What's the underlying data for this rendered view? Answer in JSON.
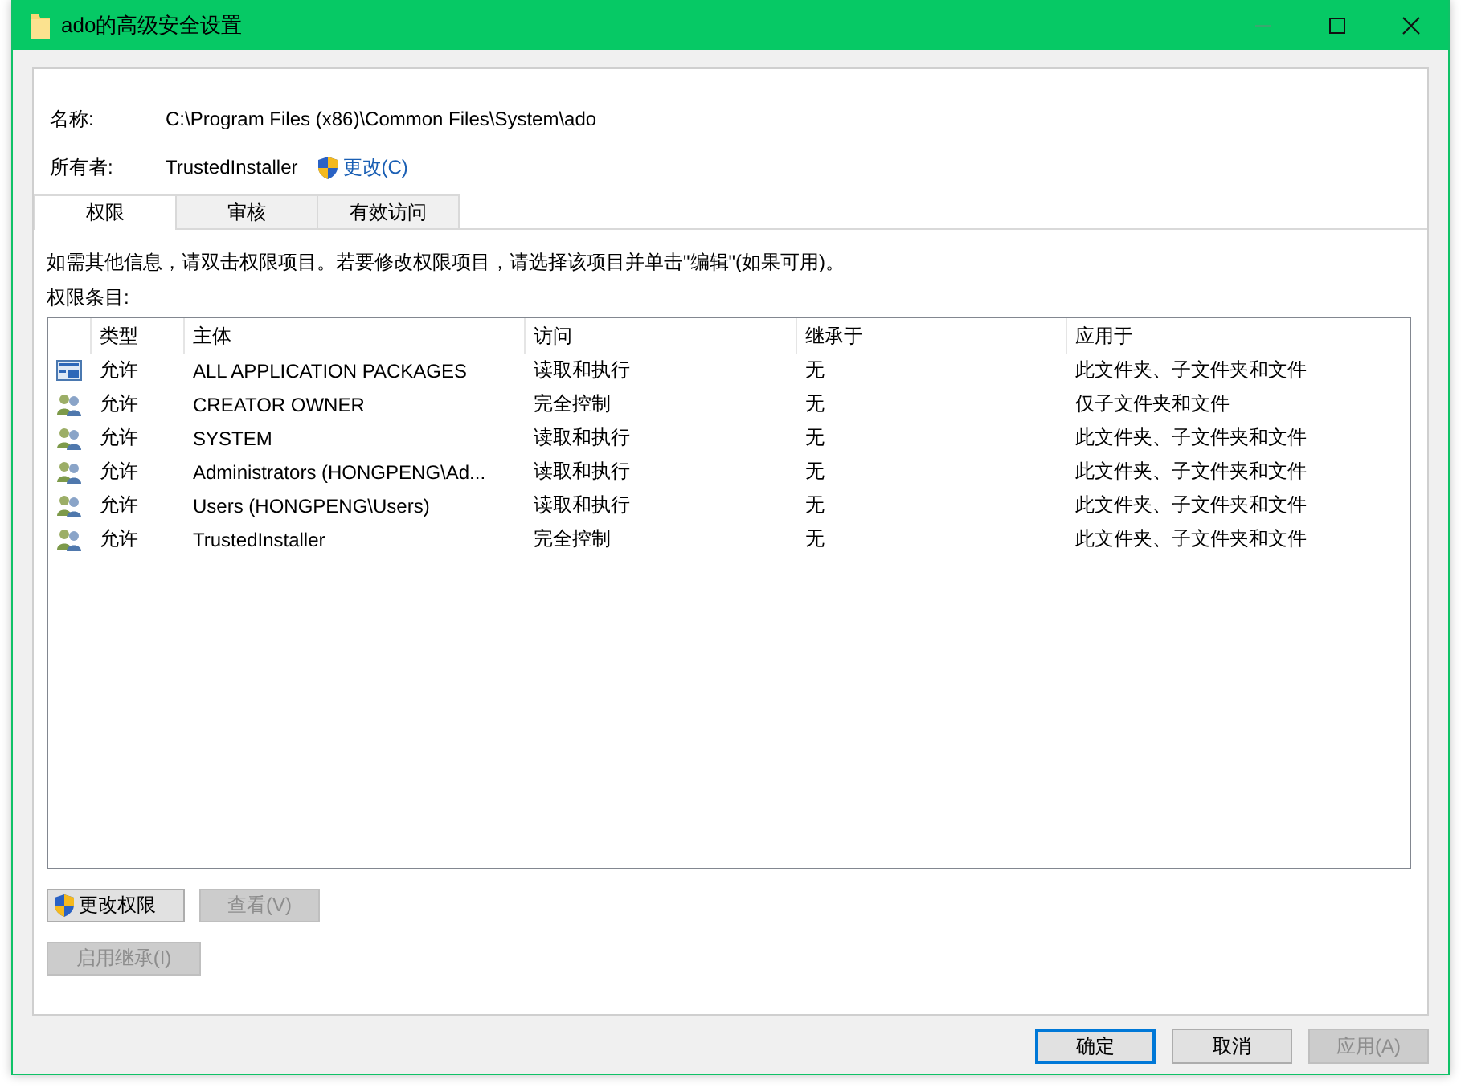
{
  "window": {
    "title": "ado的高级安全设置",
    "controls": [
      {
        "kind": "minimize",
        "disabled": true
      },
      {
        "kind": "maximize",
        "disabled": false
      },
      {
        "kind": "close",
        "disabled": false
      }
    ]
  },
  "fields": [
    {
      "label": "名称:",
      "value": "C:\\Program Files (x86)\\Common Files\\System\\ado"
    },
    {
      "label": "所有者:",
      "value": "TrustedInstaller",
      "link": "更改(C)"
    }
  ],
  "tabs": [
    {
      "label": "权限",
      "selected": true
    },
    {
      "label": "审核",
      "selected": false
    },
    {
      "label": "有效访问",
      "selected": false
    }
  ],
  "info_text": "如需其他信息，请双击权限项目。若要修改权限项目，请选择该项目并单击\"编辑\"(如果可用)。",
  "list_label": "权限条目:",
  "table": {
    "columns": [
      "类型",
      "主体",
      "访问",
      "继承于",
      "应用于"
    ],
    "rows": [
      {
        "kind": "package",
        "cells": [
          "允许",
          "ALL APPLICATION PACKAGES",
          "读取和执行",
          "无",
          "此文件夹、子文件夹和文件"
        ]
      },
      {
        "kind": "users",
        "cells": [
          "允许",
          "CREATOR OWNER",
          "完全控制",
          "无",
          "仅子文件夹和文件"
        ]
      },
      {
        "kind": "users",
        "cells": [
          "允许",
          "SYSTEM",
          "读取和执行",
          "无",
          "此文件夹、子文件夹和文件"
        ]
      },
      {
        "kind": "users",
        "cells": [
          "允许",
          "Administrators (HONGPENG\\Ad...",
          "读取和执行",
          "无",
          "此文件夹、子文件夹和文件"
        ]
      },
      {
        "kind": "users",
        "cells": [
          "允许",
          "Users (HONGPENG\\Users)",
          "读取和执行",
          "无",
          "此文件夹、子文件夹和文件"
        ]
      },
      {
        "kind": "users",
        "cells": [
          "允许",
          "TrustedInstaller",
          "完全控制",
          "无",
          "此文件夹、子文件夹和文件"
        ]
      }
    ]
  },
  "panel_buttons": [
    [
      {
        "label": "更改权限",
        "shield": true,
        "disabled": false
      },
      {
        "label": "查看(V)",
        "shield": false,
        "disabled": true
      }
    ],
    [
      {
        "label": "启用继承(I)",
        "shield": false,
        "disabled": true
      }
    ]
  ],
  "dialog_buttons": [
    {
      "label": "确定",
      "default": true,
      "disabled": false
    },
    {
      "label": "取消",
      "default": false,
      "disabled": false
    },
    {
      "label": "应用(A)",
      "default": false,
      "disabled": true
    }
  ]
}
